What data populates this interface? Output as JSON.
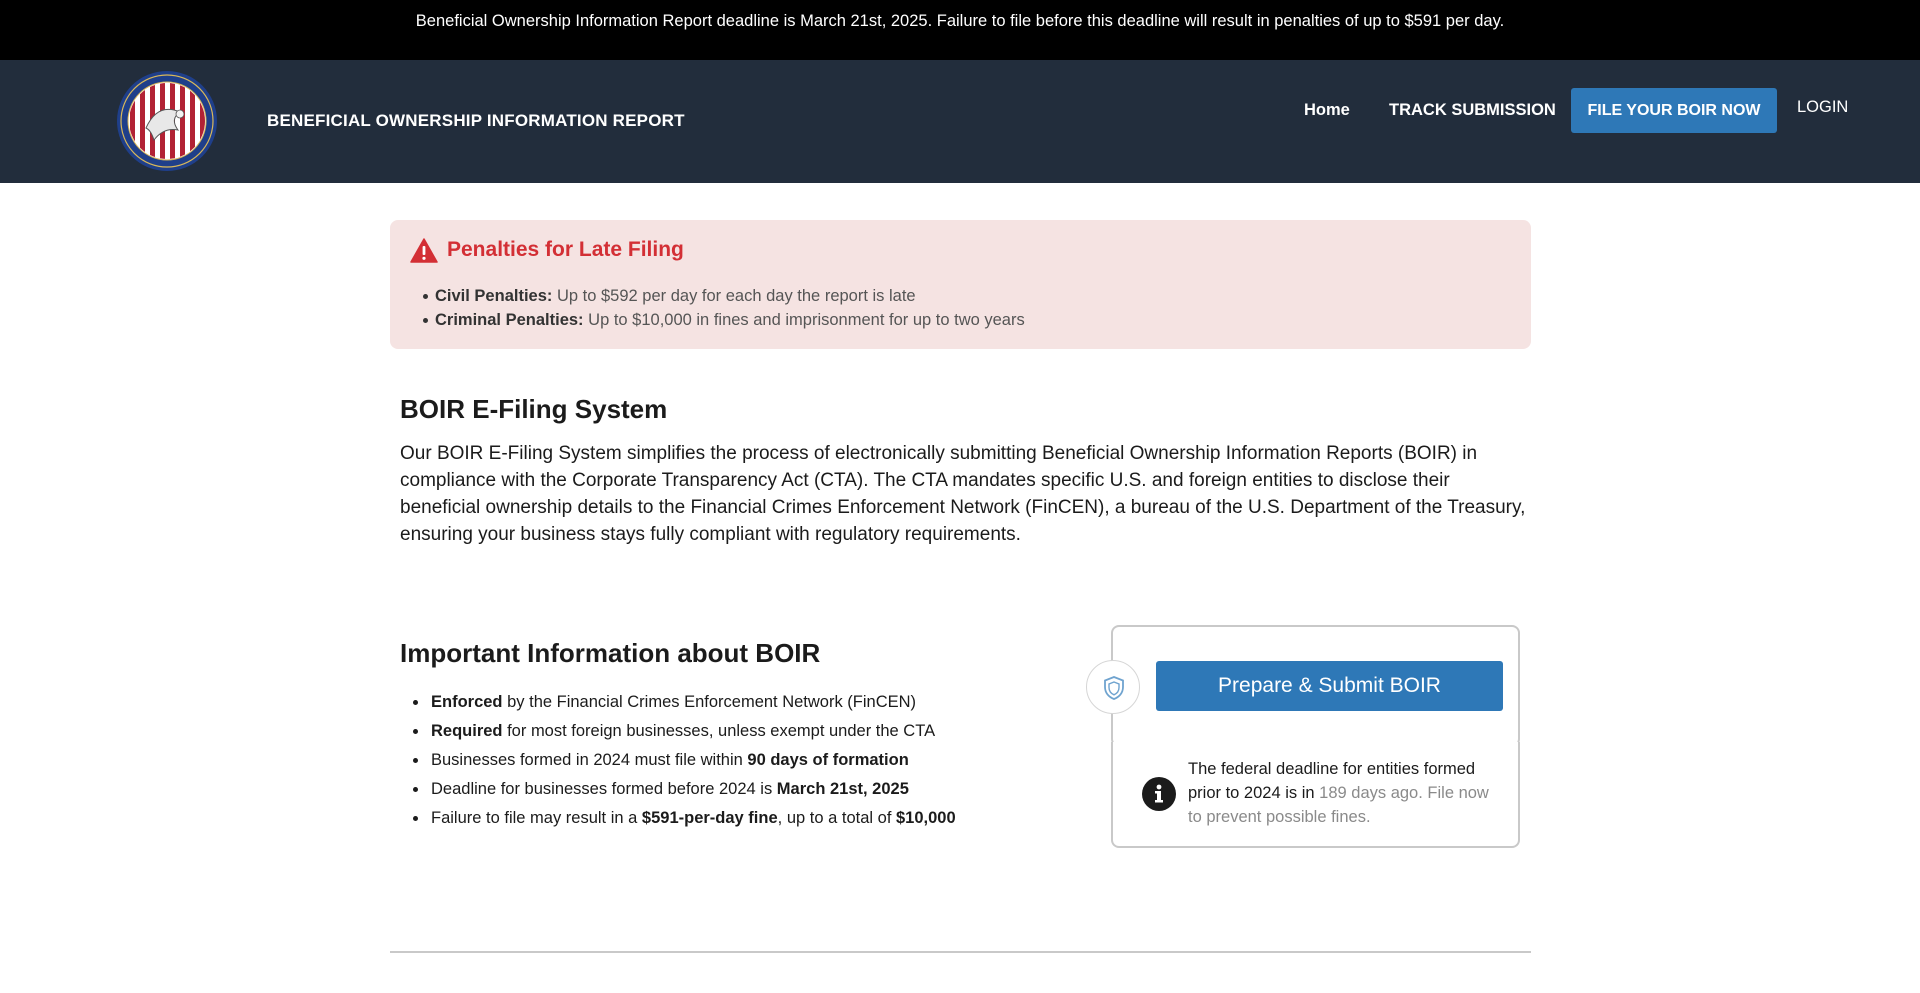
{
  "banner": {
    "text": "Beneficial Ownership Information Report deadline is March 21st, 2025. Failure to file before this deadline will result in penalties of up to $591 per day."
  },
  "header": {
    "title": "BENEFICIAL OWNERSHIP INFORMATION REPORT",
    "nav": {
      "home": "Home",
      "track": "TRACK SUBMISSION",
      "file_now": "FILE YOUR BOIR NOW",
      "login": "LOGIN"
    }
  },
  "alert": {
    "icon": "warning-triangle-icon",
    "title": "Penalties for Late Filing",
    "items": [
      {
        "label": "Civil Penalties:",
        "text": " Up to $592 per day for each day the report is late"
      },
      {
        "label": "Criminal Penalties:",
        "text": " Up to $10,000 in fines and imprisonment for up to two years"
      }
    ]
  },
  "efiling": {
    "heading": "BOIR E-Filing System",
    "paragraph": "Our BOIR E-Filing System simplifies the process of electronically submitting Beneficial Ownership Information Reports (BOIR) in compliance with the Corporate Transparency Act (CTA). The CTA mandates specific U.S. and foreign entities to disclose their beneficial ownership details to the Financial Crimes Enforcement Network (FinCEN), a bureau of the U.S. Department of the Treasury, ensuring your business stays fully compliant with regulatory requirements."
  },
  "important": {
    "heading": "Important Information about BOIR",
    "items": [
      {
        "bold": "Enforced",
        "rest": " by the Financial Crimes Enforcement Network (FinCEN)"
      },
      {
        "bold": "Required",
        "rest": " for most foreign businesses, unless exempt under the CTA"
      },
      {
        "pre": "Businesses formed in 2024 must file within ",
        "bold": "90 days of formation"
      },
      {
        "pre": "Deadline for businesses formed before 2024 is ",
        "bold": "March 21st, 2025"
      },
      {
        "pre": "Failure to file may result in a ",
        "bold": "$591-per-day fine",
        "mid": ", up to a total of ",
        "bold2": "$10,000"
      }
    ]
  },
  "card": {
    "shield_icon": "shield-icon",
    "button": "Prepare & Submit BOIR",
    "info_icon": "info-icon",
    "deadline_prefix": "The federal deadline for entities formed prior to 2024 is in ",
    "deadline_muted": "189 days ago. File now to prevent possible fines."
  },
  "colors": {
    "banner_bg": "#000000",
    "header_bg": "#222d3c",
    "accent_blue": "#2e78b7",
    "alert_bg": "#f5e3e2",
    "alert_red": "#d32f35"
  }
}
